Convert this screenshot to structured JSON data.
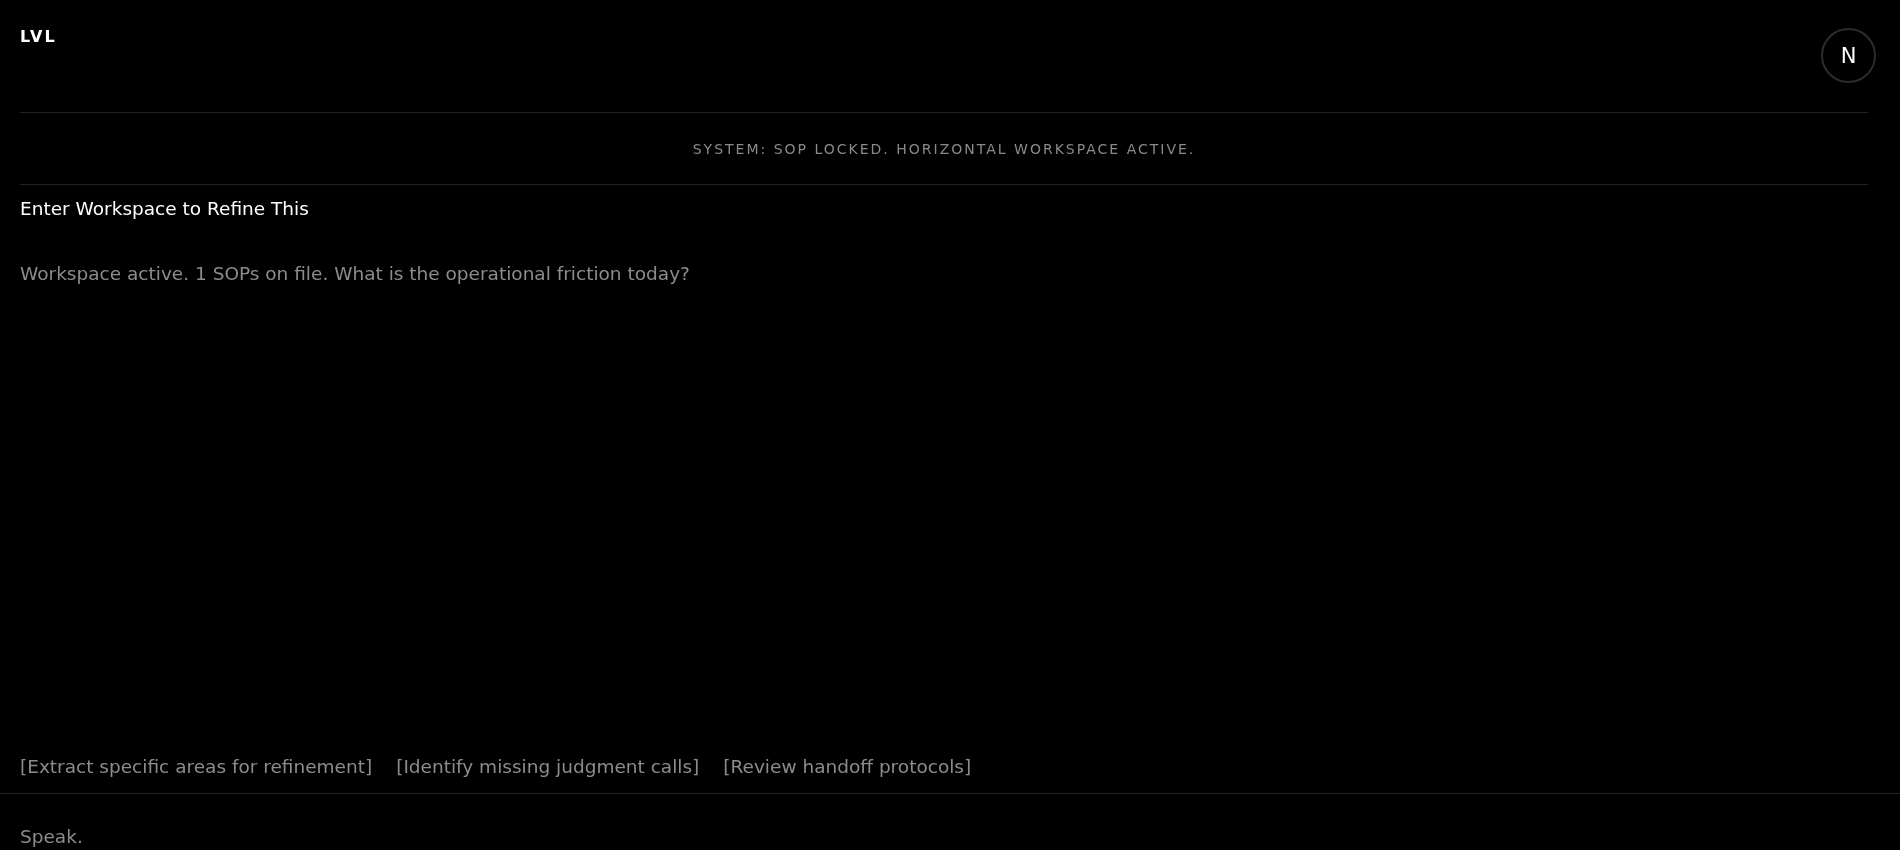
{
  "header": {
    "logo": "LVL",
    "corner_button": {
      "label": "N"
    }
  },
  "status_banner": "SYSTEM: SOP LOCKED. HORIZONTAL WORKSPACE ACTIVE.",
  "workspace": {
    "title": "Enter Workspace to Refine This",
    "messages": [
      "Workspace active. 1 SOPs on file. What is the operational friction today?"
    ]
  },
  "suggestions": [
    "[Extract specific areas for refinement]",
    "[Identify missing judgment calls]",
    "[Review handoff protocols]"
  ],
  "composer": {
    "placeholder": "Speak."
  }
}
